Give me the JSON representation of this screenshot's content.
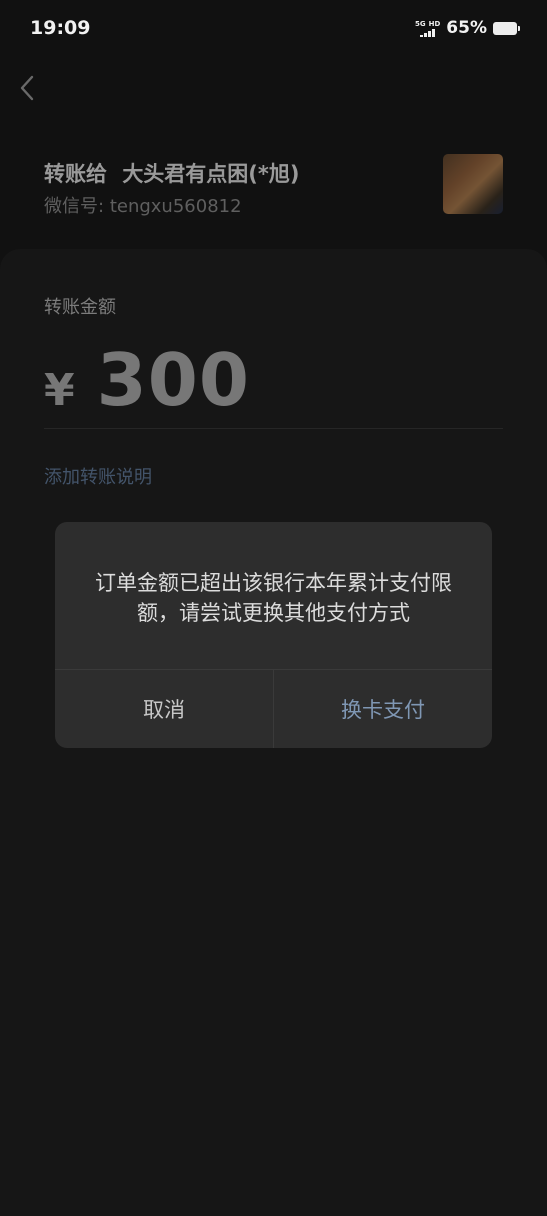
{
  "status_bar": {
    "time": "19:09",
    "network": "5G",
    "hd": "HD",
    "battery_percent": "65%"
  },
  "header": {
    "back_icon": "chevron-left-icon",
    "payee_prefix": "转账给",
    "payee_name": "大头君有点困(*旭)",
    "wechat_id_label": "微信号:",
    "wechat_id": "tengxu560812"
  },
  "transfer": {
    "amount_label": "转账金额",
    "currency_symbol": "¥",
    "amount": "300",
    "add_note_link": "添加转账说明"
  },
  "dialog": {
    "message": "订单金额已超出该银行本年累计支付限额，请尝试更换其他支付方式",
    "cancel_label": "取消",
    "switch_card_label": "换卡支付"
  },
  "colors": {
    "background": "#111111",
    "dialog_bg": "#2d2d2d",
    "link_blue": "#7f97b4"
  }
}
